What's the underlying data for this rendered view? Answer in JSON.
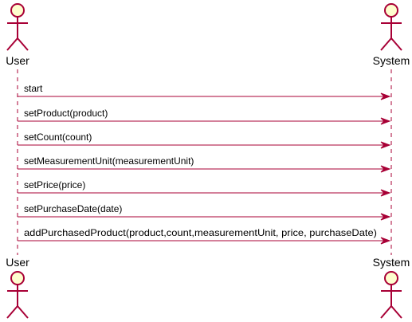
{
  "participants": [
    {
      "id": "user",
      "label": "User"
    },
    {
      "id": "system",
      "label": "System"
    }
  ],
  "messages": [
    {
      "from": "user",
      "to": "system",
      "label": "start"
    },
    {
      "from": "user",
      "to": "system",
      "label": "setProduct(product)"
    },
    {
      "from": "user",
      "to": "system",
      "label": "setCount(count)"
    },
    {
      "from": "user",
      "to": "system",
      "label": "setMeasurementUnit(measurementUnit)"
    },
    {
      "from": "user",
      "to": "system",
      "label": "setPrice(price)"
    },
    {
      "from": "user",
      "to": "system",
      "label": "setPurchaseDate(date)"
    },
    {
      "from": "user",
      "to": "system",
      "label": "addPurchasedProduct(product,count,measurementUnit, price, purchaseDate)"
    }
  ],
  "colors": {
    "actor_fill": "#FEFECE",
    "actor_stroke": "#A80036",
    "arrow": "#A80036",
    "lifeline": "#A80036",
    "text": "#000000"
  }
}
